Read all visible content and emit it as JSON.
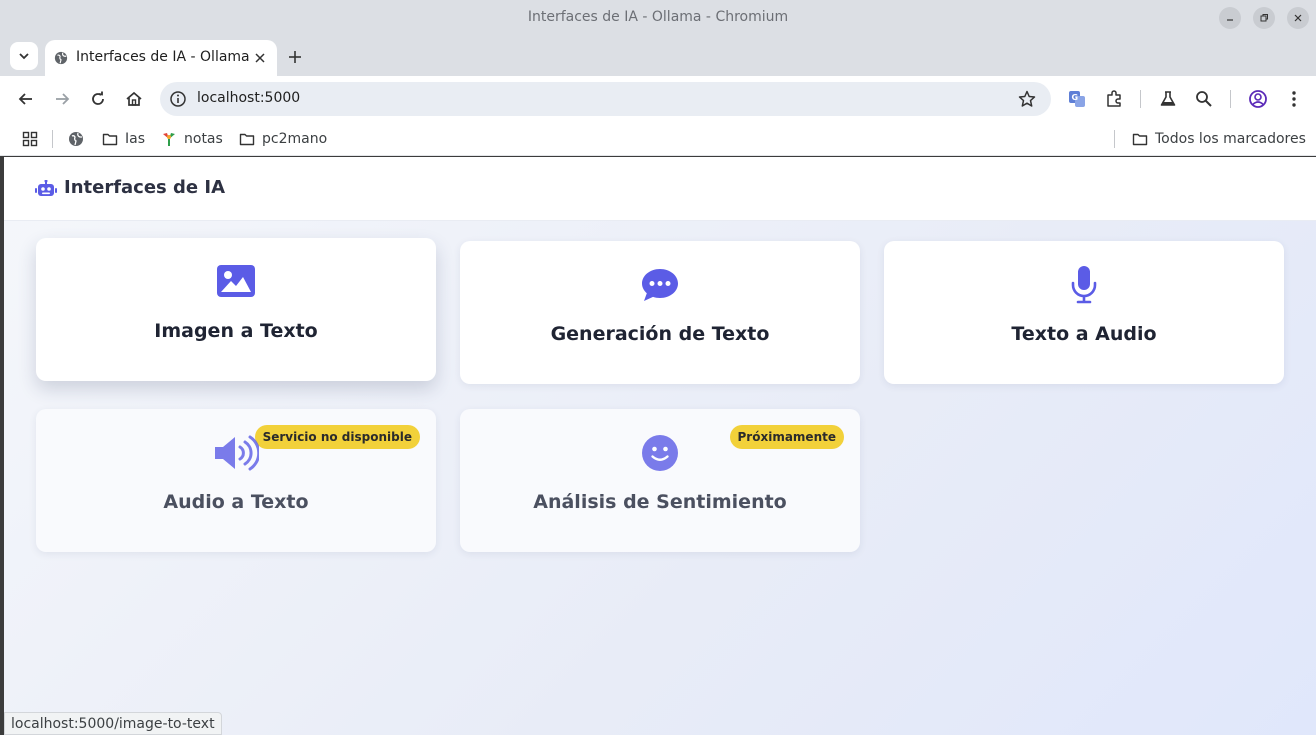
{
  "window": {
    "title": "Interfaces de IA - Ollama - Chromium"
  },
  "tabs": [
    {
      "title": "Interfaces de IA - Ollama",
      "favicon": "globe-icon"
    }
  ],
  "toolbar": {
    "url": "localhost:5000"
  },
  "bookmarks": {
    "items": [
      {
        "label": "",
        "icon": "globe-icon"
      },
      {
        "label": "Ias",
        "icon": "folder-icon"
      },
      {
        "label": "notas",
        "icon": "bookmark-favicon"
      },
      {
        "label": "pc2mano",
        "icon": "folder-icon"
      }
    ],
    "all_bookmarks": "Todos los marcadores"
  },
  "app": {
    "brand": "Interfaces de IA",
    "accent": "#5b5ce6",
    "badge_color": "#f2d13a"
  },
  "cards": [
    {
      "title": "Imagen a Texto",
      "icon": "image-icon",
      "badge": ""
    },
    {
      "title": "Generación de Texto",
      "icon": "chat-bubble-icon",
      "badge": ""
    },
    {
      "title": "Texto a Audio",
      "icon": "microphone-icon",
      "badge": ""
    },
    {
      "title": "Audio a Texto",
      "icon": "volume-icon",
      "badge": "Servicio no disponible"
    },
    {
      "title": "Análisis de Sentimiento",
      "icon": "smile-icon",
      "badge": "Próximamente"
    }
  ],
  "statusbar": {
    "url": "localhost:5000/image-to-text"
  }
}
